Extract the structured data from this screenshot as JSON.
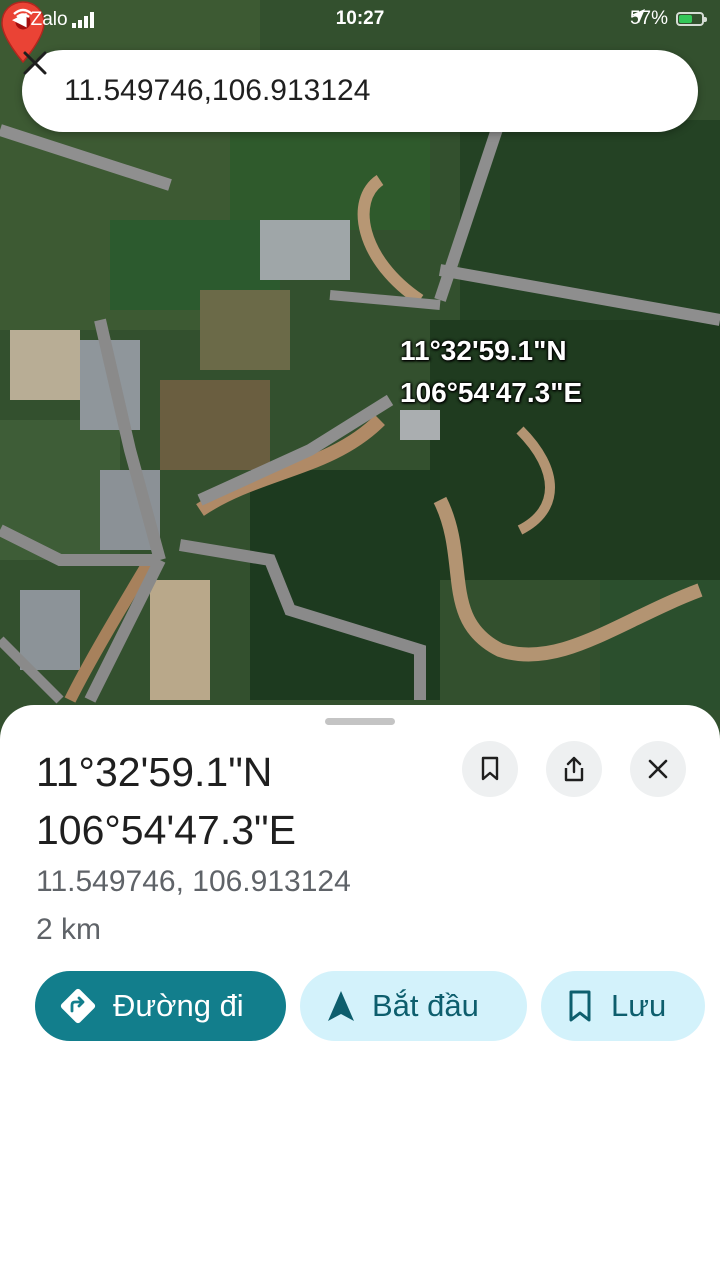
{
  "status_bar": {
    "back_app": "Zalo",
    "time": "10:27",
    "battery": "57%",
    "battery_level": 0.57
  },
  "search": {
    "query": "11.549746,106.913124"
  },
  "map": {
    "pin_label_lat": "11°32'59.1\"N",
    "pin_label_lng": "106°54'47.3\"E"
  },
  "place": {
    "title_lat": "11°32'59.1\"N",
    "title_lng": "106°54'47.3\"E",
    "decimal_coords": "11.549746, 106.913124",
    "distance": "2 km"
  },
  "actions": {
    "directions_label": "Đường đi",
    "start_label": "Bắt đầu",
    "save_label": "Lưu"
  },
  "colors": {
    "primary_chip": "#127e8c",
    "secondary_chip": "#d3f2fb",
    "pin": "#ea4335"
  }
}
